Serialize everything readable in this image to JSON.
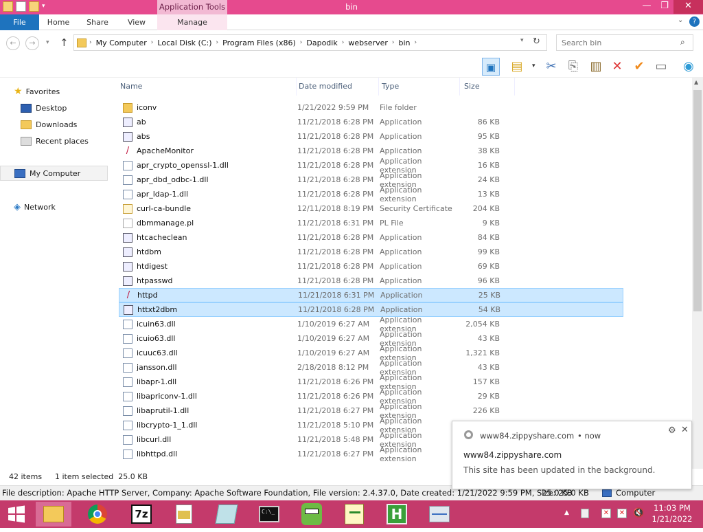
{
  "window": {
    "title": "bin",
    "context_tab": "Application Tools",
    "close_glyph": "✕",
    "minimize_glyph": "—",
    "maximize_glyph": "❐"
  },
  "ribbon": {
    "tabs": [
      "File",
      "Home",
      "Share",
      "View",
      "Manage"
    ],
    "help": "?"
  },
  "address": {
    "crumbs": [
      "My Computer",
      "Local Disk (C:)",
      "Program Files (x86)",
      "Dapodik",
      "webserver",
      "bin"
    ],
    "refresh_glyph": "↻"
  },
  "search": {
    "placeholder": "Search bin"
  },
  "nav": {
    "favorites": "Favorites",
    "desktop": "Desktop",
    "downloads": "Downloads",
    "recent": "Recent places",
    "computer": "My Computer",
    "network": "Network"
  },
  "columns": {
    "name": "Name",
    "date": "Date modified",
    "type": "Type",
    "size": "Size"
  },
  "files": [
    {
      "name": "iconv",
      "date": "1/21/2022 9:59 PM",
      "type": "File folder",
      "size": "",
      "icon": "folder"
    },
    {
      "name": "ab",
      "date": "11/21/2018 6:28 PM",
      "type": "Application",
      "size": "86 KB",
      "icon": "app"
    },
    {
      "name": "abs",
      "date": "11/21/2018 6:28 PM",
      "type": "Application",
      "size": "95 KB",
      "icon": "app"
    },
    {
      "name": "ApacheMonitor",
      "date": "11/21/2018 6:28 PM",
      "type": "Application",
      "size": "38 KB",
      "icon": "feather"
    },
    {
      "name": "apr_crypto_openssl-1.dll",
      "date": "11/21/2018 6:28 PM",
      "type": "Application extension",
      "size": "16 KB",
      "icon": "dll"
    },
    {
      "name": "apr_dbd_odbc-1.dll",
      "date": "11/21/2018 6:28 PM",
      "type": "Application extension",
      "size": "24 KB",
      "icon": "dll"
    },
    {
      "name": "apr_ldap-1.dll",
      "date": "11/21/2018 6:28 PM",
      "type": "Application extension",
      "size": "13 KB",
      "icon": "dll"
    },
    {
      "name": "curl-ca-bundle",
      "date": "12/11/2018 8:19 PM",
      "type": "Security Certificate",
      "size": "204 KB",
      "icon": "cert"
    },
    {
      "name": "dbmmanage.pl",
      "date": "11/21/2018 6:31 PM",
      "type": "PL File",
      "size": "9 KB",
      "icon": "file"
    },
    {
      "name": "htcacheclean",
      "date": "11/21/2018 6:28 PM",
      "type": "Application",
      "size": "84 KB",
      "icon": "app"
    },
    {
      "name": "htdbm",
      "date": "11/21/2018 6:28 PM",
      "type": "Application",
      "size": "99 KB",
      "icon": "app"
    },
    {
      "name": "htdigest",
      "date": "11/21/2018 6:28 PM",
      "type": "Application",
      "size": "69 KB",
      "icon": "app"
    },
    {
      "name": "htpasswd",
      "date": "11/21/2018 6:28 PM",
      "type": "Application",
      "size": "96 KB",
      "icon": "app"
    },
    {
      "name": "httpd",
      "date": "11/21/2018 6:31 PM",
      "type": "Application",
      "size": "25 KB",
      "icon": "feather",
      "selected": true
    },
    {
      "name": "httxt2dbm",
      "date": "11/21/2018 6:28 PM",
      "type": "Application",
      "size": "54 KB",
      "icon": "app",
      "hover": true
    },
    {
      "name": "icuin63.dll",
      "date": "1/10/2019 6:27 AM",
      "type": "Application extension",
      "size": "2,054 KB",
      "icon": "dll"
    },
    {
      "name": "icuio63.dll",
      "date": "1/10/2019 6:27 AM",
      "type": "Application extension",
      "size": "43 KB",
      "icon": "dll"
    },
    {
      "name": "icuuc63.dll",
      "date": "1/10/2019 6:27 AM",
      "type": "Application extension",
      "size": "1,321 KB",
      "icon": "dll"
    },
    {
      "name": "jansson.dll",
      "date": "2/18/2018 8:12 PM",
      "type": "Application extension",
      "size": "43 KB",
      "icon": "dll"
    },
    {
      "name": "libapr-1.dll",
      "date": "11/21/2018 6:26 PM",
      "type": "Application extension",
      "size": "157 KB",
      "icon": "dll"
    },
    {
      "name": "libapriconv-1.dll",
      "date": "11/21/2018 6:26 PM",
      "type": "Application extension",
      "size": "29 KB",
      "icon": "dll"
    },
    {
      "name": "libaprutil-1.dll",
      "date": "11/21/2018 6:27 PM",
      "type": "Application extension",
      "size": "226 KB",
      "icon": "dll"
    },
    {
      "name": "libcrypto-1_1.dll",
      "date": "11/21/2018 5:10 PM",
      "type": "Application extension",
      "size": "",
      "icon": "dll"
    },
    {
      "name": "libcurl.dll",
      "date": "11/21/2018 5:48 PM",
      "type": "Application extension",
      "size": "",
      "icon": "dll"
    },
    {
      "name": "libhttpd.dll",
      "date": "11/21/2018 6:27 PM",
      "type": "Application extension",
      "size": "",
      "icon": "dll"
    }
  ],
  "status": {
    "items": "42 items",
    "selected": "1 item selected  25.0 KB"
  },
  "details": {
    "description": "File description: Apache HTTP Server, Company: Apache Software Foundation, File version: 2.4.37.0, Date created: 1/21/2022 9:59 PM, Size: 25.0 KB",
    "size": "25.0 KB",
    "location": "Computer"
  },
  "toast": {
    "source": "www84.zippyshare.com",
    "time": "• now",
    "title": "www84.zippyshare.com",
    "message": "This site has been updated in the background."
  },
  "clock": {
    "time": "11:03 PM",
    "date": "1/21/2022"
  },
  "colors": {
    "titlebar": "#e64a8e",
    "taskbar": "#c43a6b",
    "selection": "#cce8ff"
  }
}
